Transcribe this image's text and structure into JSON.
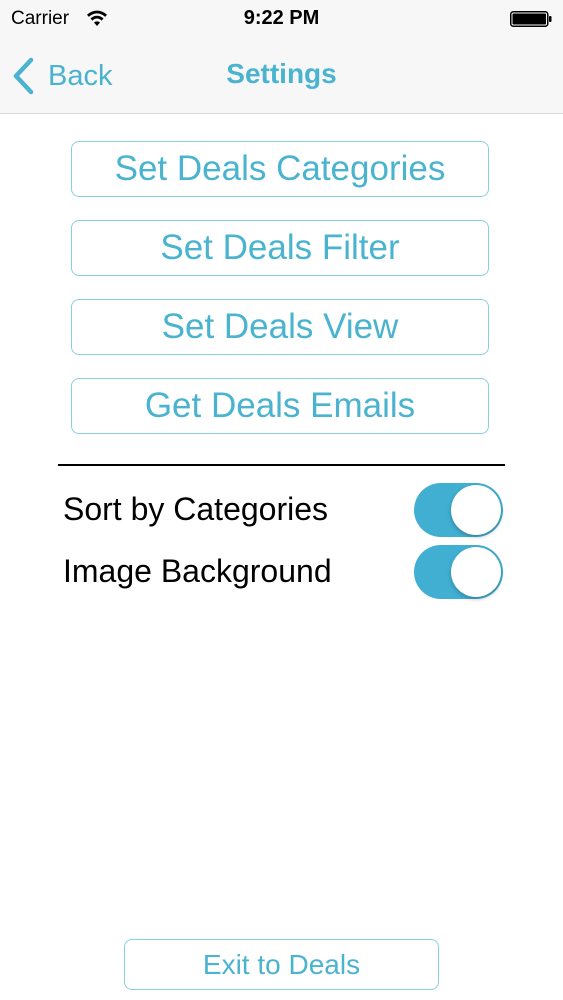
{
  "status_bar": {
    "carrier": "Carrier",
    "time": "9:22 PM"
  },
  "nav": {
    "back_label": "Back",
    "title": "Settings"
  },
  "buttons": {
    "categories": "Set Deals Categories",
    "filter": "Set Deals Filter",
    "view": "Set Deals View",
    "emails": "Get Deals Emails"
  },
  "settings": {
    "sort_by_categories": {
      "label": "Sort by Categories",
      "on": true
    },
    "image_background": {
      "label": "Image Background",
      "on": true
    }
  },
  "exit_label": "Exit to Deals",
  "colors": {
    "accent": "#4ab3cf",
    "button_border": "#86d0e2",
    "toggle_on": "#40afd2"
  }
}
